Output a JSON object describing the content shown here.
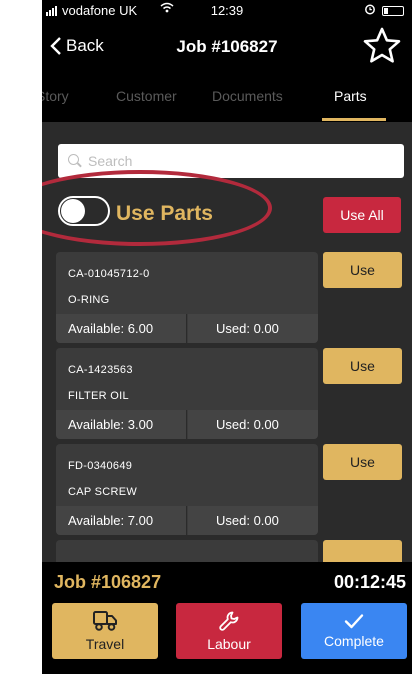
{
  "status_bar": {
    "carrier": "vodafone UK",
    "time": "12:39"
  },
  "nav": {
    "back_label": "Back",
    "title": "Job #106827"
  },
  "tabs": [
    {
      "label": "Story",
      "active": false
    },
    {
      "label": "Customer",
      "active": false
    },
    {
      "label": "Documents",
      "active": false
    },
    {
      "label": "Parts",
      "active": true
    }
  ],
  "search": {
    "placeholder": "Search",
    "value": ""
  },
  "use_parts": {
    "label": "Use Parts",
    "enabled": false
  },
  "use_all_label": "Use All",
  "parts": [
    {
      "code": "CA-01045712-0",
      "name": "O-RING",
      "available": "Available: 6.00",
      "used": "Used: 0.00",
      "button": "Use"
    },
    {
      "code": "CA-1423563",
      "name": "FILTER OIL",
      "available": "Available: 3.00",
      "used": "Used: 0.00",
      "button": "Use"
    },
    {
      "code": "FD-0340649",
      "name": "CAP SCREW",
      "available": "Available: 7.00",
      "used": "Used: 0.00",
      "button": "Use"
    }
  ],
  "footer": {
    "job_number": "Job #106827",
    "timer": "00:12:45",
    "actions": [
      {
        "label": "Travel",
        "icon": "truck-icon",
        "color": "#e0b660"
      },
      {
        "label": "Labour",
        "icon": "wrench-icon",
        "color": "#c8283f"
      },
      {
        "label": "Complete",
        "icon": "check-icon",
        "color": "#3a86f2"
      }
    ]
  },
  "colors": {
    "accent": "#e0b660",
    "danger": "#c8283f",
    "primary": "#3a86f2",
    "annotation": "#b22a3c"
  }
}
